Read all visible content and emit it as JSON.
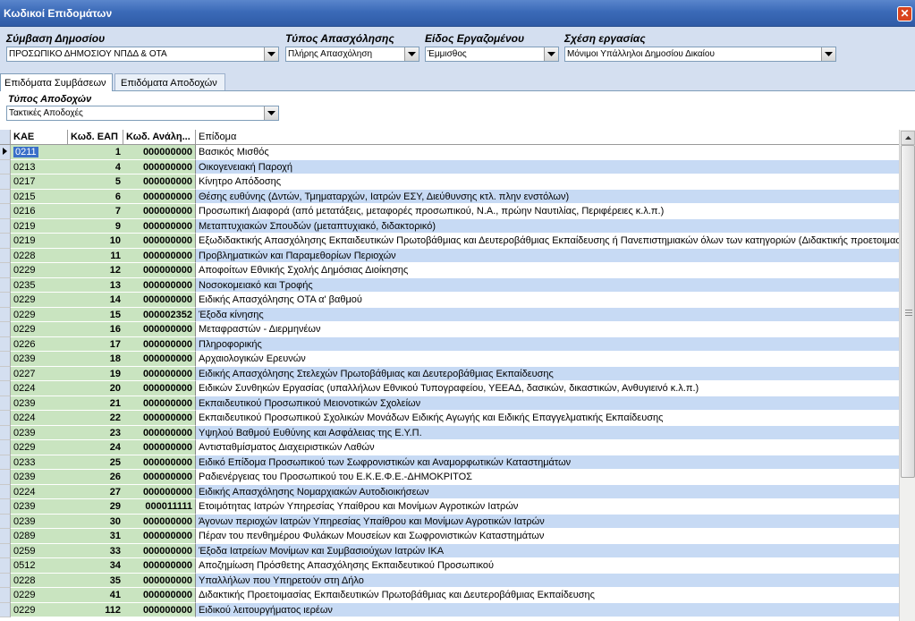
{
  "window": {
    "title": "Κωδικοί Επιδομάτων"
  },
  "filters": {
    "contract": {
      "label": "Σύμβαση Δημοσίου",
      "value": "ΠΡΟΣΩΠΙΚΟ ΔΗΜΟΣΙΟΥ ΝΠΔΔ & ΟΤΑ"
    },
    "employment": {
      "label": "Τύπος Απασχόλησης",
      "value": "Πλήρης Απασχόληση"
    },
    "worker": {
      "label": "Είδος Εργαζομένου",
      "value": "Έμμισθος"
    },
    "relation": {
      "label": "Σχέση εργασίας",
      "value": "Μόνιμοι Υπάλληλοι Δημοσίου Δικαίου"
    }
  },
  "tabs": [
    {
      "label": "Επιδόματα Συμβάσεων"
    },
    {
      "label": "Επιδόματα Αποδοχών"
    }
  ],
  "payment_type": {
    "label": "Τύπος Αποδοχών",
    "value": "Τακτικές Αποδοχές"
  },
  "table": {
    "columns": [
      "ΚΑΕ",
      "Κωδ. ΕΑΠ",
      "Κωδ. Ανάλη...",
      "Επίδομα"
    ],
    "rows": [
      [
        "0211",
        "1",
        "000000000",
        "Βασικός Μισθός"
      ],
      [
        "0213",
        "4",
        "000000000",
        "Οικογενειακή Παροχή"
      ],
      [
        "0217",
        "5",
        "000000000",
        "Κίνητρο Απόδοσης"
      ],
      [
        "0215",
        "6",
        "000000000",
        "Θέσης ευθύνης (Δντών, Τμηματαρχών, Ιατρών ΕΣΥ, Διεύθυνσης κτλ. πλην ενστόλων)"
      ],
      [
        "0216",
        "7",
        "000000000",
        "Προσωπική Διαφορά (από μετατάξεις, μεταφορές προσωπικού, Ν.Α., πρώην Ναυτιλίας, Περιφέρειες κ.λ.π.)"
      ],
      [
        "0219",
        "9",
        "000000000",
        "Μεταπτυχιακών Σπουδών (μεταπτυχιακό, διδακτορικό)"
      ],
      [
        "0219",
        "10",
        "000000000",
        "Εξωδιδακτικής Απασχόλησης Εκπαιδευτικών Πρωτοβάθμιας και Δευτεροβάθμιας Εκπαίδευσης ή Πανεπιστημιακών όλων των κατηγοριών (Διδακτικής προετοιμασ"
      ],
      [
        "0228",
        "11",
        "000000000",
        "Προβληματικών και Παραμεθορίων Περιοχών"
      ],
      [
        "0229",
        "12",
        "000000000",
        "Αποφοίτων Εθνικής Σχολής Δημόσιας Διοίκησης"
      ],
      [
        "0235",
        "13",
        "000000000",
        "Νοσοκομειακό και Τροφής"
      ],
      [
        "0229",
        "14",
        "000000000",
        "Ειδικής Απασχόλησης ΟΤΑ α' βαθμού"
      ],
      [
        "0229",
        "15",
        "000002352",
        "Έξοδα κίνησης"
      ],
      [
        "0229",
        "16",
        "000000000",
        "Μεταφραστών - Διερμηνέων"
      ],
      [
        "0226",
        "17",
        "000000000",
        "Πληροφορικής"
      ],
      [
        "0239",
        "18",
        "000000000",
        "Αρχαιολογικών Ερευνών"
      ],
      [
        "0227",
        "19",
        "000000000",
        "Ειδικής Απασχόλησης Στελεχών Πρωτοβάθμιας και Δευτεροβάθμιας Εκπαίδευσης"
      ],
      [
        "0224",
        "20",
        "000000000",
        "Ειδικών Συνθηκών Εργασίας (υπαλλήλων Εθνικού Τυπογραφείου, ΥΕΕΑΔ, δασικών, δικαστικών, Ανθυγιεινό κ.λ.π.)"
      ],
      [
        "0239",
        "21",
        "000000000",
        "Εκπαιδευτικού Προσωπικού Μειονοτικών Σχολείων"
      ],
      [
        "0224",
        "22",
        "000000000",
        "Εκπαιδευτικού Προσωπικού Σχολικών Μονάδων Ειδικής Αγωγής και Ειδικής Επαγγελματικής Εκπαίδευσης"
      ],
      [
        "0239",
        "23",
        "000000000",
        "Υψηλού Βαθμού Ευθύνης και  Ασφάλειας της Ε.Υ.Π."
      ],
      [
        "0229",
        "24",
        "000000000",
        "Αντισταθμίσματος Διαχειριστικών Λαθών"
      ],
      [
        "0233",
        "25",
        "000000000",
        "Ειδικό Επίδομα Προσωπικού των Σωφρονιστικών και Αναμορφωτικών Καταστημάτων"
      ],
      [
        "0239",
        "26",
        "000000000",
        "Ραδιενέργειας του Προσωπικού του Ε.Κ.Ε.Φ.Ε.-ΔΗΜΟΚΡΙΤΟΣ"
      ],
      [
        "0224",
        "27",
        "000000000",
        "Ειδικής Απασχόλησης Νομαρχιακών Αυτοδιοικήσεων"
      ],
      [
        "0239",
        "29",
        "000011111",
        "Ετοιμότητας Ιατρών Υπηρεσίας Υπαίθρου και Μονίμων Αγροτικών Ιατρών"
      ],
      [
        "0239",
        "30",
        "000000000",
        "Άγονων περιοχών Ιατρών Υπηρεσίας Υπαίθρου και Μονίμων Αγροτικών Ιατρών"
      ],
      [
        "0289",
        "31",
        "000000000",
        "Πέραν του πενθημέρου Φυλάκων Μουσείων και Σωφρονιστικών Καταστημάτων"
      ],
      [
        "0259",
        "33",
        "000000000",
        "Έξοδα Ιατρείων Μονίμων και Συμβασιούχων Ιατρών ΙΚΑ"
      ],
      [
        "0512",
        "34",
        "000000000",
        "Αποζημίωση Πρόσθετης Απασχόλησης Εκπαιδευτικού Προσωπικού"
      ],
      [
        "0228",
        "35",
        "000000000",
        "Υπαλλήλων που Υπηρετούν στη Δήλο"
      ],
      [
        "0229",
        "41",
        "000000000",
        "Διδακτικής Προετοιμασίας Εκπαιδευτικών Πρωτοβάθμιας και Δευτεροβάθμιας Εκπαίδευσης"
      ],
      [
        "0229",
        "112",
        "000000000",
        "Ειδικού λειτουργήματος ιερέων"
      ]
    ]
  },
  "icons": {
    "close": "close-icon",
    "dropdown": "chevron-down-icon",
    "row_indicator": "triangle-right-icon"
  },
  "colors": {
    "titlebar": "#3b6ab8",
    "code_columns": "#c9e4c0",
    "alt_row": "#c7daf4",
    "selection": "#3a6fc8"
  }
}
